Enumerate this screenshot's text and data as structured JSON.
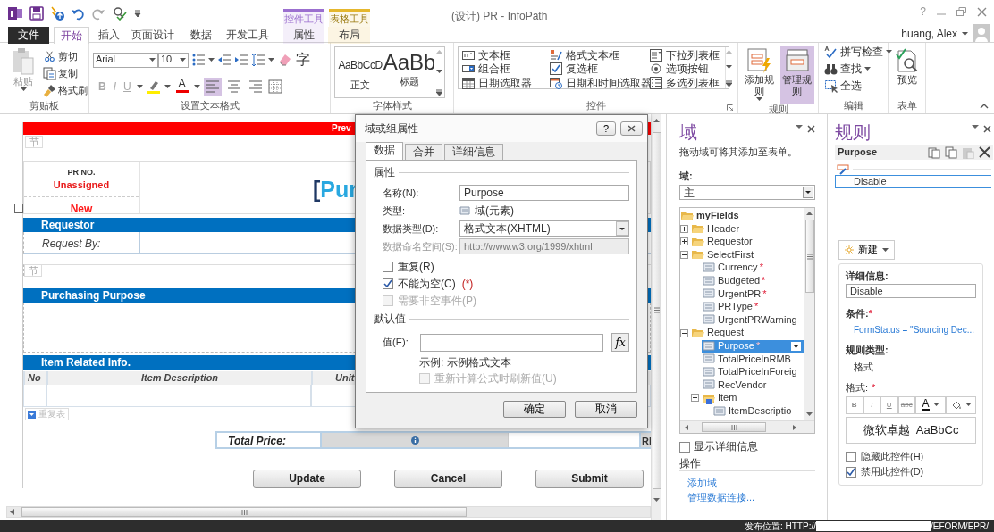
{
  "window": {
    "title": "(设计) PR - InfoPath",
    "help": "?",
    "user": "huang, Alex"
  },
  "context_tabs": [
    {
      "label": "控件工具",
      "color": "#9b6fcf"
    },
    {
      "label": "表格工具",
      "color": "#e5b72d"
    }
  ],
  "ribbon_tabs": [
    {
      "label": "文件",
      "kind": "file",
      "selected": false
    },
    {
      "label": "开始",
      "kind": "plain",
      "selected": true
    },
    {
      "label": "插入",
      "kind": "plain",
      "selected": false
    },
    {
      "label": "页面设计",
      "kind": "plain",
      "selected": false
    },
    {
      "label": "数据",
      "kind": "plain",
      "selected": false
    },
    {
      "label": "开发工具",
      "kind": "plain",
      "selected": false
    },
    {
      "label": "属性",
      "kind": "control",
      "selected": false
    },
    {
      "label": "布局",
      "kind": "table",
      "selected": false
    }
  ],
  "clipboard": {
    "label": "剪贴板",
    "paste": "粘贴",
    "paste_disabled": true,
    "commands": [
      "剪切",
      "复制",
      "格式刷"
    ]
  },
  "text_format": {
    "label": "设置文本格式",
    "font": "Arial",
    "size": "10",
    "phonetic": "字",
    "font_color": "A",
    "emphasis": [
      {
        "label": "B",
        "disabled": true
      },
      {
        "label": "I",
        "disabled": true
      },
      {
        "label": "U",
        "disabled": true
      }
    ],
    "align": [
      {
        "selected": true
      },
      {
        "selected": false
      },
      {
        "selected": false
      }
    ]
  },
  "font_styles": {
    "label": "字体样式",
    "styles": [
      {
        "sample": "AaBbCcD",
        "name": "正文"
      },
      {
        "sample": "AaBb",
        "name": "标题"
      }
    ]
  },
  "controls": {
    "label": "控件",
    "items": [
      "文本框",
      "格式文本框",
      "下拉列表框",
      "组合框",
      "复选框",
      "选项按钮",
      "日期选取器",
      "日期和时间选取器",
      "多选列表框"
    ]
  },
  "rules_group": {
    "label": "规则",
    "buttons": [
      {
        "label": "添加规则",
        "selected": false
      },
      {
        "label": "管理规则",
        "selected": true
      }
    ]
  },
  "editing": {
    "label": "编辑",
    "commands": [
      "拼写检查",
      "查找",
      "全选"
    ]
  },
  "form_group": {
    "label": "表单",
    "commands": [
      "预览"
    ]
  },
  "form": {
    "banner": "Prev",
    "section_tags": [
      "节",
      "节"
    ],
    "pr_label": "PR NO.",
    "pr_number": "Unassigned",
    "status": "New",
    "heading_bracket": "[",
    "heading": "Pur",
    "requestor_title": "Requestor",
    "request_by_label": "Request By:",
    "purpose_title": "Purchasing Purpose",
    "items_title": "Item Related Info.",
    "item_columns": [
      "No",
      "Item Description",
      "Unit"
    ],
    "repeat_table": "重复表",
    "total_label": "Total Price:",
    "total_currency": "RI",
    "buttons": [
      "Update",
      "Cancel",
      "Submit"
    ]
  },
  "dialog": {
    "title": "域或组属性",
    "help": "?",
    "tabs": [
      {
        "label": "数据",
        "selected": true
      },
      {
        "label": "合并",
        "selected": false
      },
      {
        "label": "详细信息",
        "selected": false
      }
    ],
    "properties_heading": "属性",
    "name_label": "名称(N):",
    "name_value": "Purpose",
    "type_label": "类型:",
    "type_value": "域(元素)",
    "datatype_label": "数据类型(D):",
    "datatype_value": "格式文本(XHTML)",
    "namespace_label": "数据命名空间(S):",
    "namespace_value": "http://www.w3.org/1999/xhtml",
    "namespace_disabled": true,
    "options": [
      {
        "label": "重复(R)",
        "checked": false,
        "disabled": false
      },
      {
        "label": "不能为空(C)",
        "note": "(*)",
        "checked": true,
        "disabled": false
      },
      {
        "label": "需要非空事件(P)",
        "checked": false,
        "disabled": true
      }
    ],
    "default_heading": "默认值",
    "value_label": "值(E):",
    "formula_button": "fx",
    "example": "示例: 示例格式文本",
    "recalc": {
      "label": "重新计算公式时刷新值(U)",
      "checked": false,
      "disabled": true
    },
    "buttons": [
      "确定",
      "取消"
    ]
  },
  "fields_pane": {
    "title": "域",
    "hint": "拖动域可将其添加至表单。",
    "source_label": "域:",
    "source_value": "主",
    "tree": [
      {
        "label": "myFields",
        "kind": "folder",
        "selected": false,
        "children": [
          {
            "label": "Header",
            "kind": "folder",
            "expanded": false,
            "selected": false
          },
          {
            "label": "Requestor",
            "kind": "folder",
            "expanded": false,
            "selected": false
          },
          {
            "label": "SelectFirst",
            "kind": "folder",
            "expanded": true,
            "selected": false,
            "children": [
              {
                "label": "Currency",
                "marker": "*",
                "kind": "field",
                "selected": false
              },
              {
                "label": "Budgeted",
                "marker": "*",
                "kind": "field",
                "selected": false
              },
              {
                "label": "UrgentPR",
                "marker": "*",
                "kind": "field",
                "selected": false
              },
              {
                "label": "PRType",
                "marker": "*",
                "kind": "field",
                "selected": false
              },
              {
                "label": "UrgentPRWarning",
                "kind": "field",
                "selected": false
              }
            ]
          },
          {
            "label": "Request",
            "kind": "folder",
            "expanded": true,
            "selected": false,
            "children": [
              {
                "label": "Purpose",
                "marker": "*",
                "kind": "field",
                "selected": true
              },
              {
                "label": "TotalPriceInRMB",
                "kind": "field",
                "selected": false
              },
              {
                "label": "TotalPriceInForeig",
                "kind": "field",
                "selected": false
              },
              {
                "label": "RecVendor",
                "kind": "field",
                "selected": false
              },
              {
                "label": "Item",
                "kind": "repeating",
                "expanded": true,
                "selected": false,
                "children": [
                  {
                    "label": "ItemDescriptio",
                    "kind": "field",
                    "selected": false
                  }
                ]
              }
            ]
          }
        ]
      }
    ],
    "show_details": {
      "label": "显示详细信息",
      "checked": false
    },
    "actions_heading": "操作",
    "actions": [
      "添加域",
      "管理数据连接..."
    ]
  },
  "rules_pane": {
    "title": "规则",
    "control_name": "Purpose",
    "rules": [
      {
        "label": "Disable",
        "selected": true
      }
    ],
    "new_button": "新建",
    "details_label": "详细信息:",
    "details_value": "Disable",
    "condition_label": "条件:",
    "condition_mark": "*",
    "condition": "FormStatus = \"Sourcing Dec...",
    "rule_type_label": "规则类型:",
    "rule_type": "格式",
    "format_label": "格式:",
    "format_mark": "*",
    "format_buttons": [
      "B",
      "I",
      "U",
      "abc"
    ],
    "font_color": "A",
    "preview": "微软卓越  AaBbCc",
    "options": [
      {
        "label": "隐藏此控件(H)",
        "checked": false
      },
      {
        "label": "禁用此控件(D)",
        "checked": true
      }
    ]
  },
  "status_bar": {
    "label": "发布位置: HTTP://",
    "path": "/EFORM/EPR/"
  }
}
